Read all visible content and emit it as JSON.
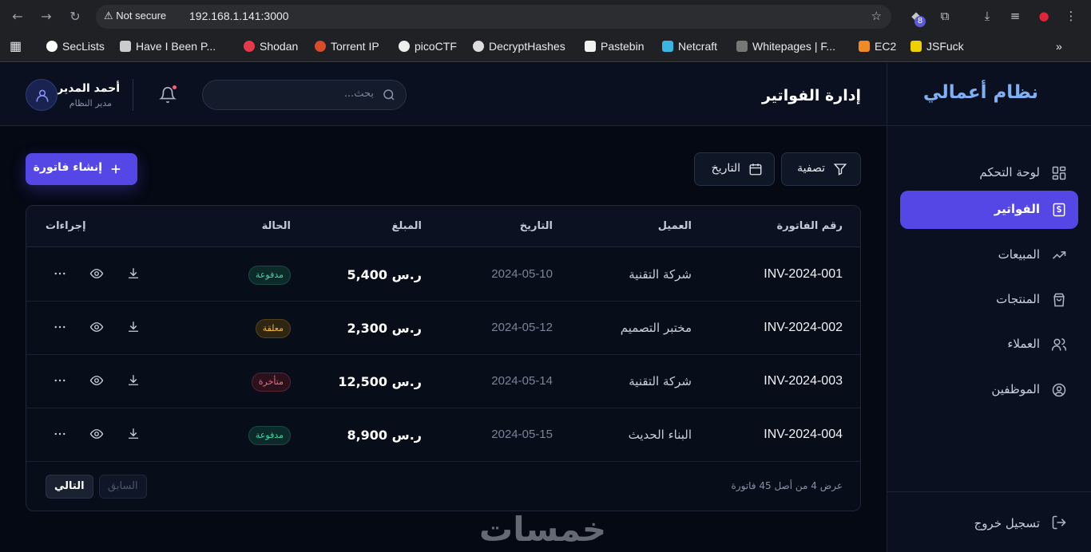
{
  "browser": {
    "security_label": "Not secure",
    "url": "192.168.1.141:3000",
    "extension_badge": "8",
    "bookmarks": [
      "SecLists",
      "Have I Been P...",
      "Shodan",
      "Torrent IP",
      "picoCTF",
      "DecryptHashes",
      "Pastebin",
      "Netcraft",
      "Whitepages | F...",
      "EC2",
      "JSFuck"
    ]
  },
  "sidebar": {
    "brand": "نظام أعمالي",
    "items": [
      {
        "label": "لوحة التحكم",
        "icon": "grid-icon"
      },
      {
        "label": "الفواتير",
        "icon": "invoice-icon",
        "active": true
      },
      {
        "label": "المبيعات",
        "icon": "trend-icon"
      },
      {
        "label": "المنتجات",
        "icon": "bag-icon"
      },
      {
        "label": "العملاء",
        "icon": "users-icon"
      },
      {
        "label": "الموظفين",
        "icon": "user-circle-icon"
      }
    ],
    "logout": "تسجيل خروج"
  },
  "header": {
    "title": "إدارة الفواتير",
    "search_placeholder": "بحث...",
    "user_name": "أحمد المدير",
    "user_role": "مدير النظام"
  },
  "toolbar": {
    "filter_label": "تصفية",
    "date_label": "التاريخ",
    "create_label": "إنشاء فاتورة"
  },
  "table": {
    "columns": [
      "رقم الفاتورة",
      "العميل",
      "التاريخ",
      "المبلغ",
      "الحالة",
      "إجراءات"
    ],
    "rows": [
      {
        "id": "INV-2024-001",
        "client": "شركة التقنية",
        "date": "2024-05-10",
        "amount": "5,400 ر.س",
        "status": "مدفوعة",
        "status_type": "paid"
      },
      {
        "id": "INV-2024-002",
        "client": "مختبر التصميم",
        "date": "2024-05-12",
        "amount": "2,300 ر.س",
        "status": "معلقة",
        "status_type": "pending"
      },
      {
        "id": "INV-2024-003",
        "client": "شركة التقنية",
        "date": "2024-05-14",
        "amount": "12,500 ر.س",
        "status": "متأخرة",
        "status_type": "late"
      },
      {
        "id": "INV-2024-004",
        "client": "البناء الحديث",
        "date": "2024-05-15",
        "amount": "8,900 ر.س",
        "status": "مدفوعة",
        "status_type": "paid"
      }
    ],
    "footer_text": "عرض 4 من أصل 45 فاتورة",
    "prev_label": "السابق",
    "next_label": "التالي"
  },
  "watermark": "خمسات",
  "colors": {
    "accent": "#5547e6",
    "paid": "#3ed4a7",
    "pending": "#f0b93a",
    "late": "#f26b84"
  }
}
